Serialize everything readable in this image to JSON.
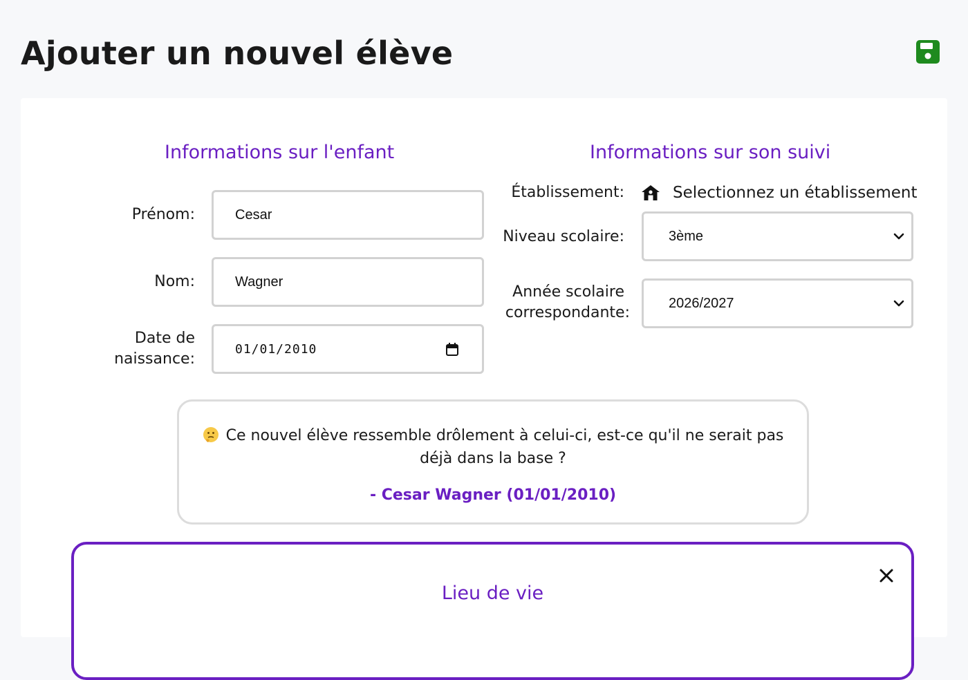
{
  "page": {
    "title": "Ajouter un nouvel élève",
    "save_icon": "floppy-disk-icon"
  },
  "colors": {
    "accent": "#6a1fc2",
    "save_green": "#1e8a1e",
    "border": "#d2d2d2"
  },
  "child_info": {
    "title": "Informations sur l'enfant",
    "first_name_label": "Prénom:",
    "first_name_value": "Cesar",
    "last_name_label": "Nom:",
    "last_name_value": "Wagner",
    "birthdate_label_line1": "Date de",
    "birthdate_label_line2": "naissance:",
    "birthdate_value": "01/01/2010"
  },
  "follow_up": {
    "title": "Informations sur son suivi",
    "school_label": "Établissement:",
    "school_value": "Selectionnez un établissement",
    "level_label": "Niveau scolaire:",
    "level_value": "3ème",
    "year_label_line1": "Année scolaire",
    "year_label_line2": "correspondante:",
    "year_value": "2026/2027"
  },
  "duplicate_hint": {
    "emoji": "thinking-face-icon",
    "text": "Ce nouvel élève ressemble drôlement à celui-ci, est-ce qu'il ne serait pas déjà dans la base ?",
    "match": "- Cesar Wagner (01/01/2010)"
  },
  "lieu_de_vie": {
    "title": "Lieu de vie"
  }
}
